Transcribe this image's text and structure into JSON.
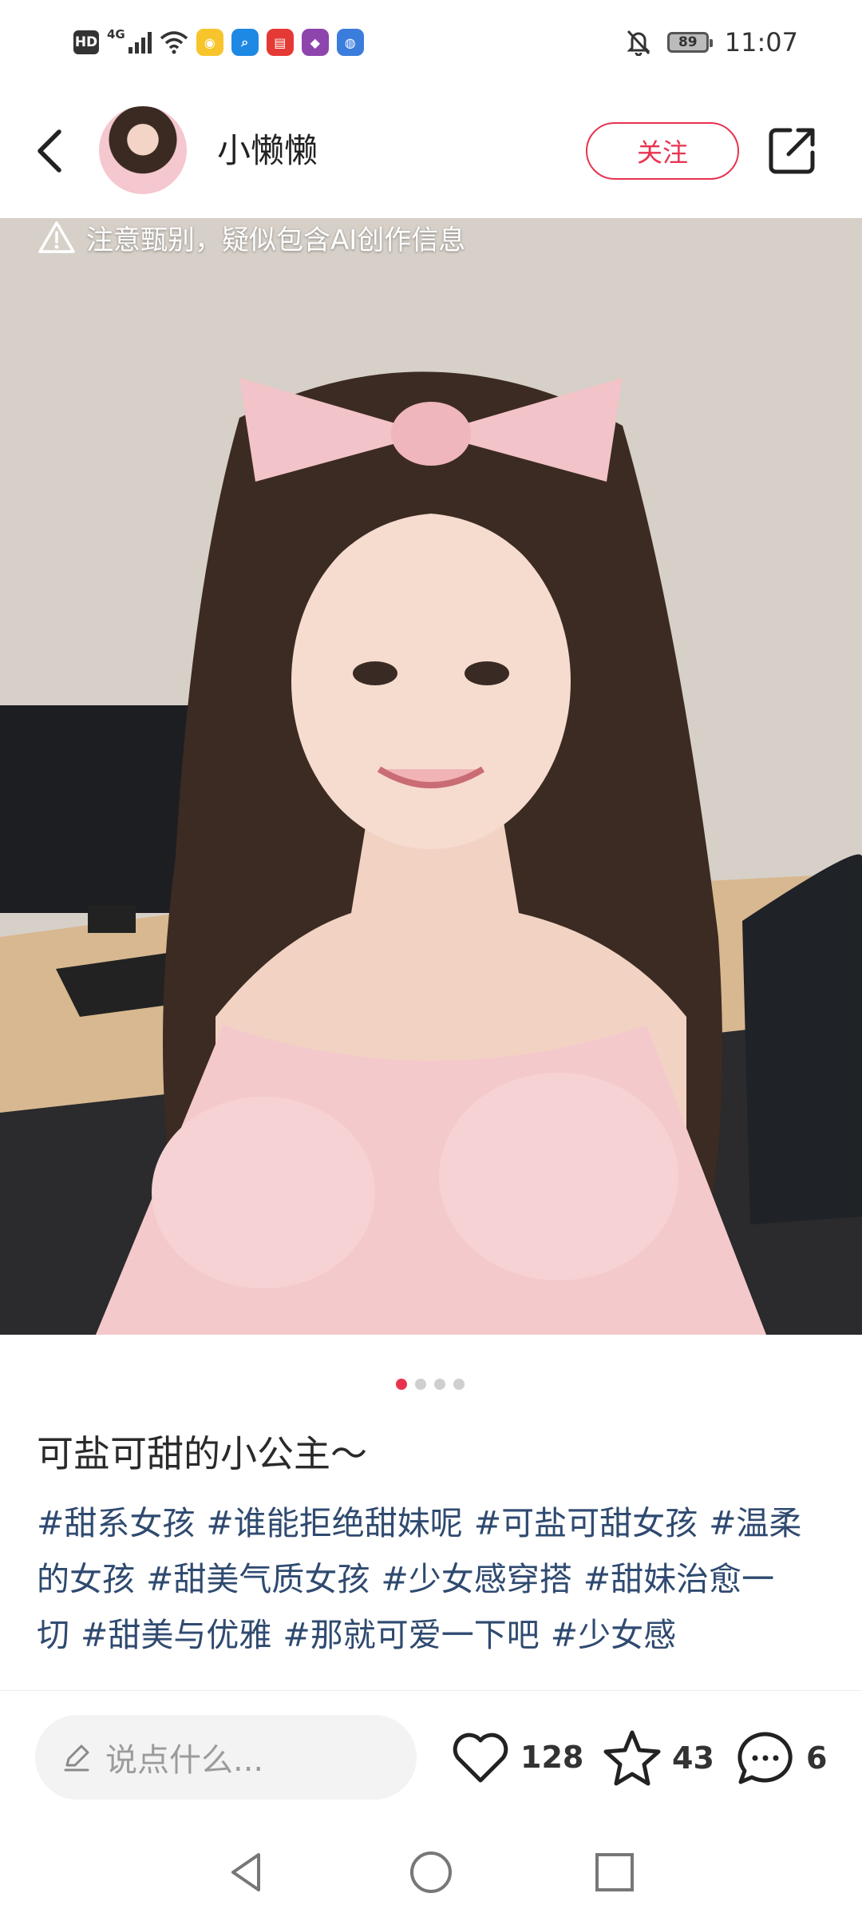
{
  "status_bar": {
    "hd": "HD",
    "network": "4G",
    "battery": "89",
    "time": "11:07",
    "app_icons": [
      {
        "name": "weibo-icon",
        "color": "#f7c52b",
        "glyph": "◉"
      },
      {
        "name": "search-app-icon",
        "color": "#1e88e5",
        "glyph": "⌕"
      },
      {
        "name": "huawei-store-icon",
        "color": "#e53935",
        "glyph": "▤"
      },
      {
        "name": "colorful-app-icon",
        "color": "#8e44ad",
        "glyph": "◆"
      },
      {
        "name": "browser-icon",
        "color": "#3b7ddd",
        "glyph": "◍"
      }
    ]
  },
  "header": {
    "username": "小懒懒",
    "follow_label": "关注"
  },
  "post": {
    "ai_warning": "注意甄别，疑似包含AI创作信息",
    "image_count": 4,
    "current_image": 1,
    "title": "可盐可甜的小公主～",
    "tags": [
      "#甜系女孩",
      "#谁能拒绝甜妹呢",
      "#可盐可甜女孩",
      "#温柔的女孩",
      "#甜美气质女孩",
      "#少女感穿搭",
      "#甜妹治愈一切",
      "#甜美与优雅",
      "#那就可爱一下吧",
      "#少女感"
    ]
  },
  "bottom": {
    "comment_placeholder": "说点什么...",
    "likes": "128",
    "favorites": "43",
    "comments": "6"
  },
  "colors": {
    "accent": "#e8334f",
    "tag": "#2f4a70"
  }
}
